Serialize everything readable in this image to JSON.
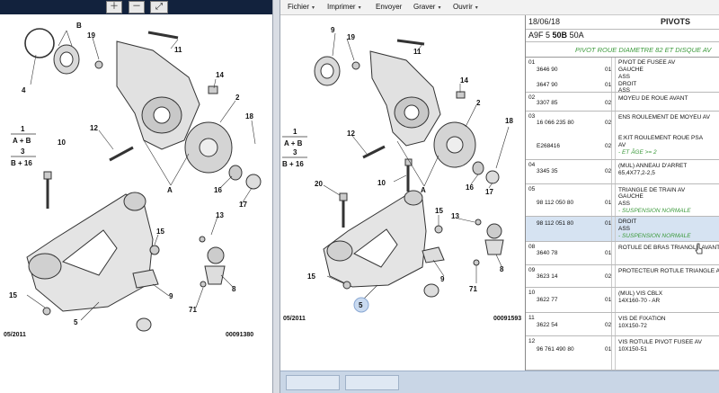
{
  "left": {
    "toolbar": {
      "buttons": [
        "zoom-in",
        "zoom-out",
        "zoom-fit"
      ]
    },
    "callouts": [
      "4",
      "B",
      "19",
      "11",
      "14",
      "2",
      "18",
      "1",
      "A + B",
      "3",
      "B + 16",
      "10",
      "12",
      "16",
      "17",
      "A",
      "13",
      "15",
      "9",
      "8",
      "71",
      "5",
      "15"
    ],
    "date": "05/2011",
    "ref": "00091380"
  },
  "right": {
    "menu": [
      {
        "label": "Fichier",
        "has_arrow": true
      },
      {
        "label": "Imprimer",
        "has_arrow": true
      },
      {
        "label": "Envoyer",
        "has_arrow": false
      },
      {
        "label": "Graver",
        "has_arrow": true
      },
      {
        "label": "Ouvrir",
        "has_arrow": true
      }
    ],
    "drawing": {
      "callouts": [
        "9",
        "19",
        "11",
        "14",
        "2",
        "18",
        "1",
        "A + B",
        "3",
        "B + 16",
        "12",
        "16",
        "17",
        "A",
        "10",
        "20",
        "13",
        "15",
        "9",
        "8",
        "71",
        "15",
        "5"
      ],
      "date": "05/2011",
      "ref": "00091593"
    },
    "parts": {
      "date": "18/06/18",
      "title": "PIVOTS",
      "codes_a": "A9F 5",
      "codes_b": "50B",
      "codes_c": "50A",
      "subtitle": "PIVOT ROUE DIAMETRE 82 ET DISQUE AV",
      "rows": [
        {
          "group": "01",
          "lines": [
            {
              "ref": "3646 90",
              "qty": "01",
              "desc": [
                "PIVOT DE FUSEE AV",
                "GAUCHE",
                "ASS"
              ]
            },
            {
              "ref": "3647 90",
              "qty": "01",
              "desc": [
                "DROIT",
                "ASS"
              ]
            }
          ]
        },
        {
          "group": "02",
          "lines": [
            {
              "ref": "3307 85",
              "qty": "02",
              "desc": [
                "MOYEU DE ROUE AVANT"
              ]
            }
          ]
        },
        {
          "group": "03",
          "lines": [
            {
              "ref": "16 066 235 80",
              "qty": "02",
              "desc": [
                "ENS ROULEMENT DE MOYEU AV"
              ]
            },
            {
              "ref": "E268416",
              "qty": "02",
              "desc": [
                "E:KIT ROULEMENT ROUE PSA",
                "AV"
              ],
              "note": "- ET ÂGE >= 2"
            }
          ]
        },
        {
          "group": "04",
          "lines": [
            {
              "ref": "3345 35",
              "qty": "02",
              "desc": [
                "(MUL) ANNEAU D'ARRET",
                "65,4X77,2-2,5"
              ]
            }
          ]
        },
        {
          "group": "05",
          "lines": [
            {
              "ref": "98 112 050 80",
              "qty": "01",
              "desc": [
                "TRIANGLE DE TRAIN AV",
                "GAUCHE",
                "ASS"
              ],
              "note": "- SUSPENSION NORMALE"
            },
            {
              "ref": "98 112 051 80",
              "qty": "01",
              "desc": [
                "DROIT",
                "ASS"
              ],
              "note": "- SUSPENSION NORMALE",
              "selected": true
            }
          ]
        },
        {
          "group": "08",
          "lines": [
            {
              "ref": "3640 78",
              "qty": "01",
              "desc": [
                "ROTULE DE BRAS TRIANGLE AVANT"
              ]
            }
          ]
        },
        {
          "group": "09",
          "lines": [
            {
              "ref": "3623 14",
              "qty": "02",
              "desc": [
                "PROTECTEUR ROTULE TRIANGLE A"
              ]
            }
          ]
        },
        {
          "group": "10",
          "lines": [
            {
              "ref": "3622 77",
              "qty": "01",
              "desc": [
                "(MUL) VIS CBLX",
                "14X160-70 - AR"
              ]
            }
          ]
        },
        {
          "group": "11",
          "lines": [
            {
              "ref": "3622 54",
              "qty": "02",
              "desc": [
                "VIS DE FIXATION",
                "10X150-72"
              ]
            }
          ]
        },
        {
          "group": "12",
          "lines": [
            {
              "ref": "96 761 490 80",
              "qty": "01",
              "desc": [
                "VIS ROTULE PIVOT FUSEE AV",
                "10X150-51"
              ]
            }
          ]
        }
      ]
    }
  },
  "colors": {
    "toolbar": "#12223d",
    "selected_row": "#d6e3f2",
    "note_green": "#3c9a3c",
    "divider": "#d9dde4"
  }
}
